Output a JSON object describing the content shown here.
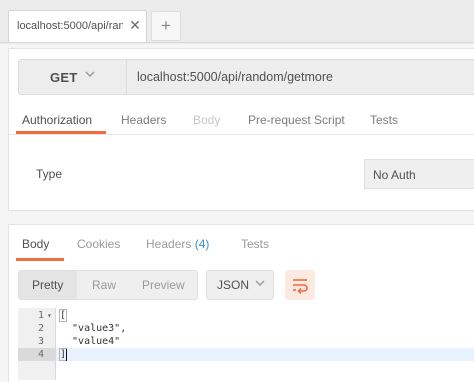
{
  "tabs": {
    "active_tab_label": "localhost:5000/api/random/getmore",
    "close_glyph": "✕",
    "add_glyph": "+"
  },
  "request": {
    "method": "GET",
    "url": "localhost:5000/api/random/getmore",
    "tabs": [
      {
        "label": "Authorization",
        "state": "active"
      },
      {
        "label": "Headers",
        "state": "normal"
      },
      {
        "label": "Body",
        "state": "disabled"
      },
      {
        "label": "Pre-request Script",
        "state": "normal"
      },
      {
        "label": "Tests",
        "state": "normal"
      }
    ],
    "auth": {
      "type_label": "Type",
      "selected": "No Auth"
    }
  },
  "response": {
    "tabs": [
      {
        "label": "Body",
        "state": "active"
      },
      {
        "label": "Cookies",
        "state": "normal"
      },
      {
        "label": "Headers",
        "count": "(4)",
        "state": "normal"
      },
      {
        "label": "Tests",
        "state": "normal"
      }
    ],
    "view_modes": [
      "Pretty",
      "Raw",
      "Preview"
    ],
    "selected_view": "Pretty",
    "format": "JSON",
    "code_lines": [
      {
        "n": "1",
        "text": "["
      },
      {
        "n": "2",
        "text": "  \"value3\","
      },
      {
        "n": "3",
        "text": "  \"value4\""
      },
      {
        "n": "4",
        "text": "]"
      }
    ]
  },
  "colors": {
    "accent": "#f26b3a",
    "count_blue": "#3a8fd6",
    "string_navy": "#1b2d7a"
  },
  "icons": [
    "close-icon",
    "add-icon",
    "chevron-down-icon",
    "wrap-lines-icon",
    "fold-arrow-icon"
  ]
}
